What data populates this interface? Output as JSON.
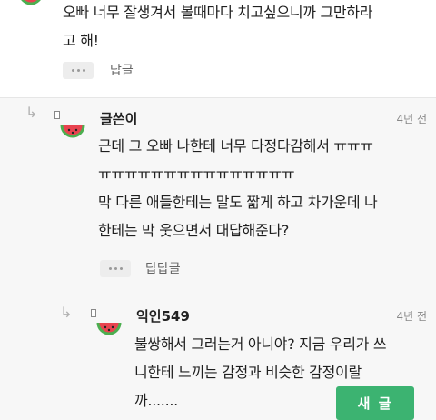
{
  "comment_top": {
    "lines": [
      "오빠 너무 잘생겨서 볼때마다 치고싶으니까 그만하라",
      "고 해!"
    ],
    "reply_label": "답글"
  },
  "reply1": {
    "author": "글쓴이",
    "time": "4년 전",
    "lines": [
      "근데 그 오빠 나한테 너무 다정다감해서 ㅠㅠㅠ",
      "ㅠㅠㅠㅠㅠㅠㅠㅠㅠㅠㅠㅠㅠㅠㅠ",
      "막 다른 애들한테는 말도 짧게 하고 차가운데 나",
      "한테는 막 웃으면서 대답해준다?"
    ],
    "reply_label": "답답글"
  },
  "reply2": {
    "author": "익인549",
    "time": "4년 전",
    "lines": [
      "불쌍해서 그러는거 아니야? 지금 우리가 쓰",
      "니한테 느끼는 감정과 비슷한 감정이랄",
      "까......."
    ]
  },
  "new_post_label": "새 글",
  "colors": {
    "accent": "#3cb371",
    "watermelon_red": "#e8434f",
    "watermelon_green": "#4caf50"
  },
  "icons": [
    "watermelon-avatar-icon",
    "reply-arrow-icon",
    "more-dots-icon"
  ]
}
